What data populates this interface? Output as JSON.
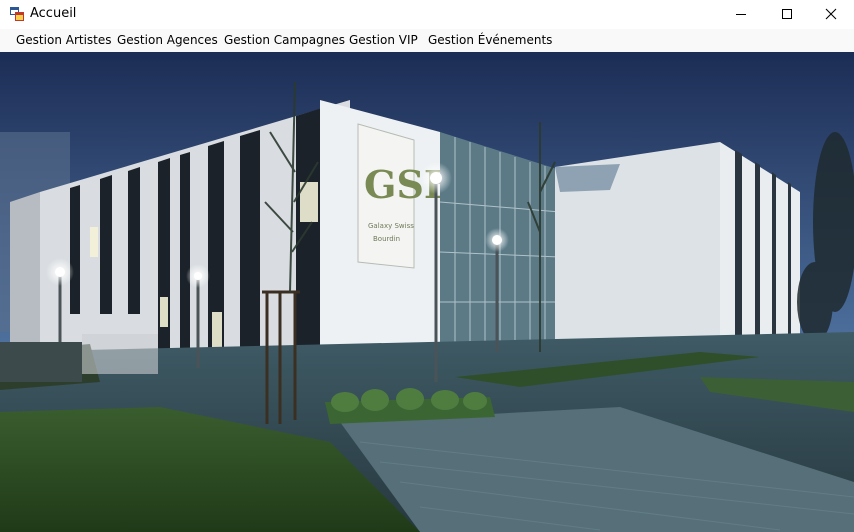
{
  "window": {
    "title": "Accueil",
    "icon": "winforms-app-icon",
    "controls": {
      "minimize": "minimize-icon",
      "maximize": "maximize-icon",
      "close": "close-icon"
    }
  },
  "menu": {
    "items": [
      {
        "label": "Gestion Artistes"
      },
      {
        "label": "Gestion Agences"
      },
      {
        "label": "Gestion Campagnes"
      },
      {
        "label": "Gestion VIP"
      },
      {
        "label": "Gestion Événements"
      }
    ]
  },
  "background": {
    "sign_logo": "GSB",
    "sign_text_line1": "Galaxy Swiss",
    "sign_text_line2": "Bourdin"
  },
  "colors": {
    "sky_top": "#1d2f57",
    "sky_bottom": "#6f8fb4",
    "building": "#e8ecef",
    "sign_logo": "#7a8a55",
    "lawn": "#2b4a22"
  }
}
